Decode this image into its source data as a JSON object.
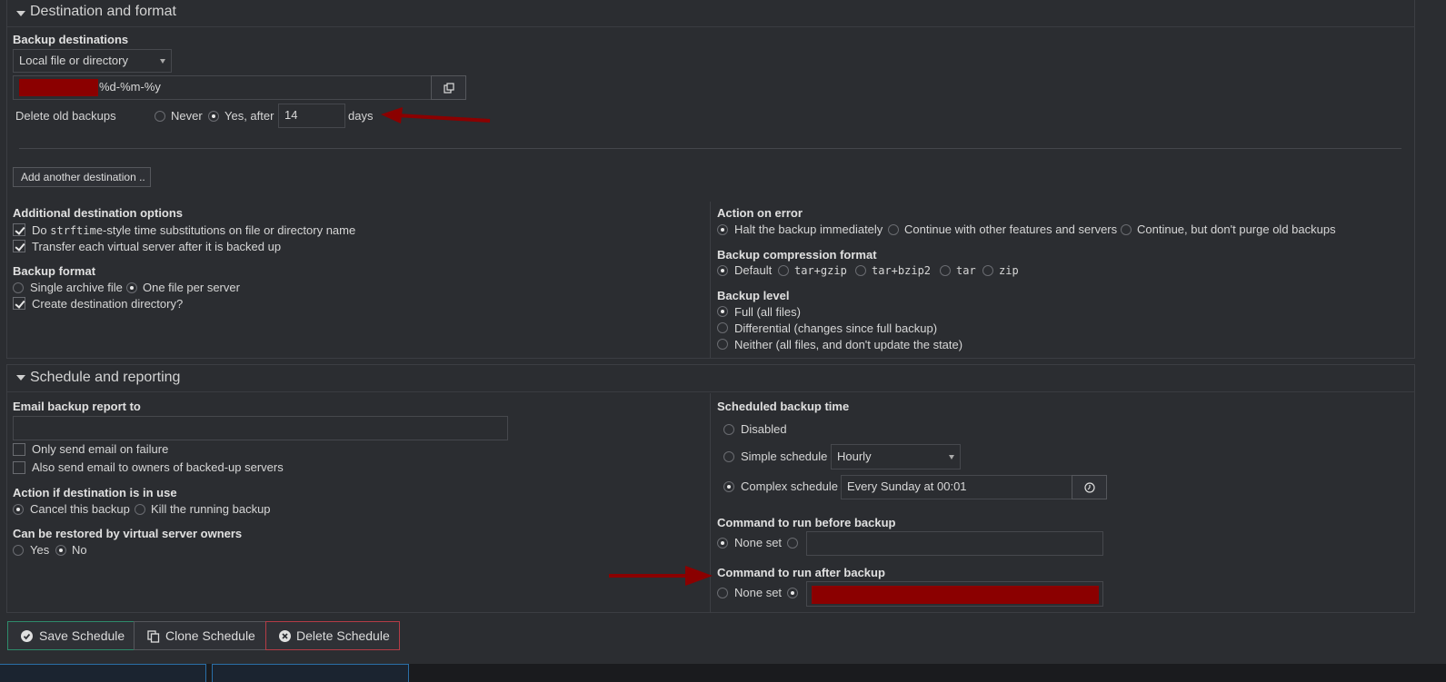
{
  "dest_panel": {
    "title": "Destination and format",
    "backup_destinations_label": "Backup destinations",
    "destination_type": "Local file or directory",
    "path_suffix": "%d-%m-%y",
    "delete_old_label": "Delete old backups",
    "never_label": "Never",
    "yes_after_label": "Yes, after",
    "days_value": "14",
    "days_label": "days",
    "add_destination_label": "Add another destination ..",
    "additional_options_label": "Additional destination options",
    "strftime_pre": "Do",
    "strftime_code": "strftime",
    "strftime_post": "-style time substitutions on file or directory name",
    "transfer_label": "Transfer each virtual server after it is backed up",
    "backup_format_label": "Backup format",
    "single_archive_label": "Single archive file",
    "one_file_label": "One file per server",
    "create_dir_label": "Create destination directory?",
    "action_on_error_label": "Action on error",
    "halt_label": "Halt the backup immediately",
    "continue_other_label": "Continue with other features and servers",
    "continue_nopurge_label": "Continue, but don't purge old backups",
    "compression_label": "Backup compression format",
    "compression_options": [
      "Default",
      "tar+gzip",
      "tar+bzip2",
      "tar",
      "zip"
    ],
    "backup_level_label": "Backup level",
    "level_full": "Full (all files)",
    "level_diff": "Differential (changes since full backup)",
    "level_neither": "Neither (all files, and don't update the state)"
  },
  "schedule_panel": {
    "title": "Schedule and reporting",
    "email_label": "Email backup report to",
    "email_value": "",
    "only_failure_label": "Only send email on failure",
    "also_owners_label": "Also send email to owners of backed-up servers",
    "dest_in_use_label": "Action if destination is in use",
    "cancel_label": "Cancel this backup",
    "kill_label": "Kill the running backup",
    "restored_label": "Can be restored by virtual server owners",
    "yes_label": "Yes",
    "no_label": "No",
    "scheduled_time_label": "Scheduled backup time",
    "disabled_label": "Disabled",
    "simple_label": "Simple schedule",
    "simple_value": "Hourly",
    "complex_label": "Complex schedule",
    "complex_value": "Every Sunday at 00:01",
    "before_label": "Command to run before backup",
    "none_set_label": "None set",
    "before_value": "",
    "after_label": "Command to run after backup"
  },
  "actions": {
    "save_label": "Save Schedule",
    "clone_label": "Clone Schedule",
    "delete_label": "Delete Schedule"
  },
  "colors": {
    "background": "#2b2d31",
    "annotation_arrow": "#8b0000",
    "save_border": "#2e8b6b",
    "delete_border": "#b43c46"
  }
}
